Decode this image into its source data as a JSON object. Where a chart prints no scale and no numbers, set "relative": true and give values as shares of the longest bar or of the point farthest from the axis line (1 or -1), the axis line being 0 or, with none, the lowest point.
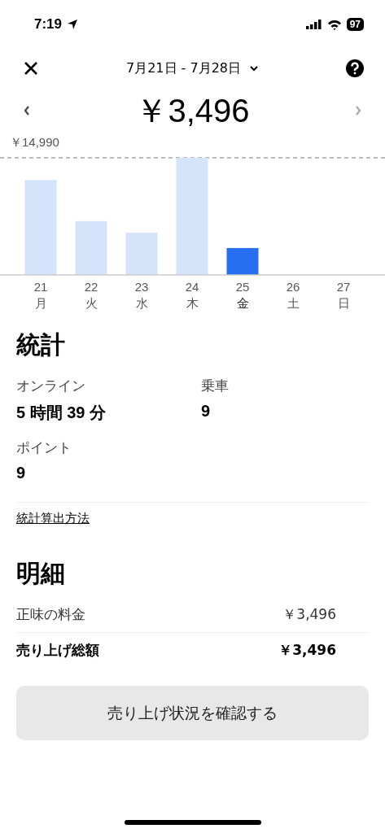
{
  "status_bar": {
    "time": "7:19",
    "battery": "97"
  },
  "header": {
    "date_range": "7月21日 - 7月28日"
  },
  "total": "￥3,496",
  "chart_data": {
    "type": "bar",
    "categories": [
      "21",
      "22",
      "23",
      "24",
      "25",
      "26",
      "27"
    ],
    "values": [
      0.81,
      0.46,
      0.36,
      1,
      0.23,
      null,
      null
    ],
    "relative": true,
    "annotations": [
      {
        "text": "￥14,990"
      }
    ]
  },
  "days": [
    {
      "weekday": "月",
      "selected": false
    },
    {
      "weekday": "火",
      "selected": false
    },
    {
      "weekday": "水",
      "selected": false
    },
    {
      "weekday": "木",
      "selected": false
    },
    {
      "weekday": "金",
      "selected": true
    },
    {
      "weekday": "土",
      "selected": false
    },
    {
      "weekday": "日",
      "selected": false
    }
  ],
  "stats": {
    "title": "統計",
    "items": [
      {
        "label": "オンライン",
        "value": "5 時間 39 分"
      },
      {
        "label": "乗車",
        "value": "9"
      },
      {
        "label": "ポイント",
        "value": "9"
      }
    ],
    "link": "統計算出方法"
  },
  "breakdown": {
    "title": "明細",
    "rows": [
      {
        "label": "正味の料金",
        "value": "￥3,496",
        "bold": false
      },
      {
        "label": "売り上げ総額",
        "value": "￥3,496",
        "bold": true
      }
    ]
  },
  "button": "売り上げ状況を確認する"
}
